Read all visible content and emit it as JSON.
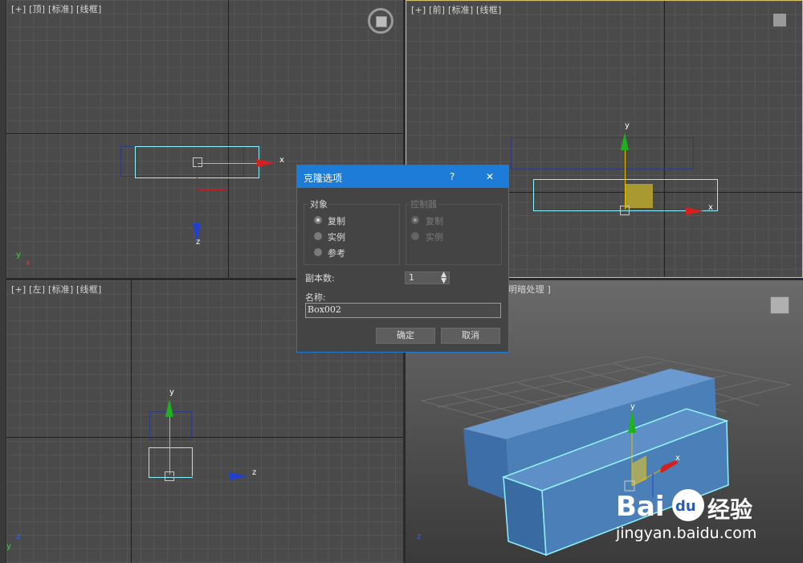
{
  "viewports": {
    "top": {
      "label": "[+] [顶] [标准] [线框]"
    },
    "front": {
      "label": "[+] [前] [标准] [线框]"
    },
    "left": {
      "label": "[+] [左] [标准] [线框]"
    },
    "perspective": {
      "label": "明暗处理 ]"
    }
  },
  "axes": {
    "x": "x",
    "y": "y",
    "z": "z"
  },
  "dialog": {
    "title": "克隆选项",
    "help": "?",
    "close": "✕",
    "object_group": {
      "label": "对象",
      "options": [
        "复制",
        "实例",
        "参考"
      ],
      "selected": 0
    },
    "controller_group": {
      "label": "控制器",
      "options": [
        "复制",
        "实例"
      ],
      "selected": 0
    },
    "copies_label": "副本数:",
    "copies_value": "1",
    "name_label": "名称:",
    "name_value": "Box002",
    "ok": "确定",
    "cancel": "取消"
  },
  "watermark": {
    "logo": "Bai",
    "du": "du",
    "brand": "经验",
    "url": "jingyan.baidu.com"
  },
  "colors": {
    "accent": "#1e7cd9",
    "selection": "#8ff3ff",
    "box": "#4a7fb8",
    "x_axis": "#d62020",
    "y_axis": "#20b020",
    "z_axis": "#2040d0"
  }
}
